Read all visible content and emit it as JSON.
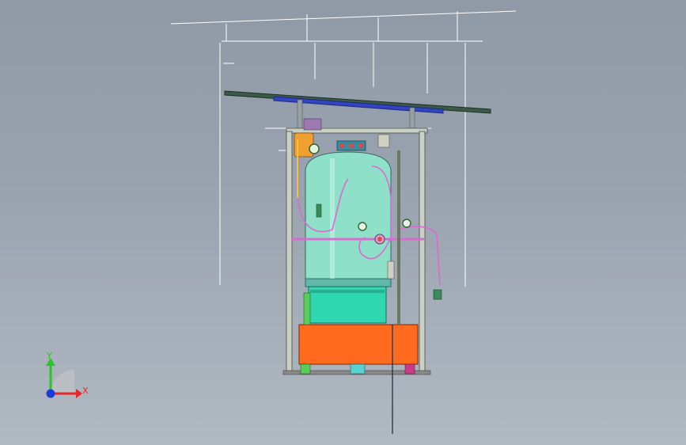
{
  "triad": {
    "x_label": "X",
    "y_label": "Y",
    "x_color": "#e8262a",
    "y_color": "#2bc22b",
    "z_color": "#1c3ad8"
  },
  "colors": {
    "background": "#9aa4b0",
    "edge_lines": "#ffffff",
    "tank": "#8fe0c8",
    "tank_lower": "#2fd6b0",
    "base_frame": "#ff6a1e",
    "frame_post": "#c9d0c4",
    "roof_panel": "#3a5a48",
    "pipe_magenta": "#d96bd0",
    "pipe_yellow": "#f0c33a"
  }
}
